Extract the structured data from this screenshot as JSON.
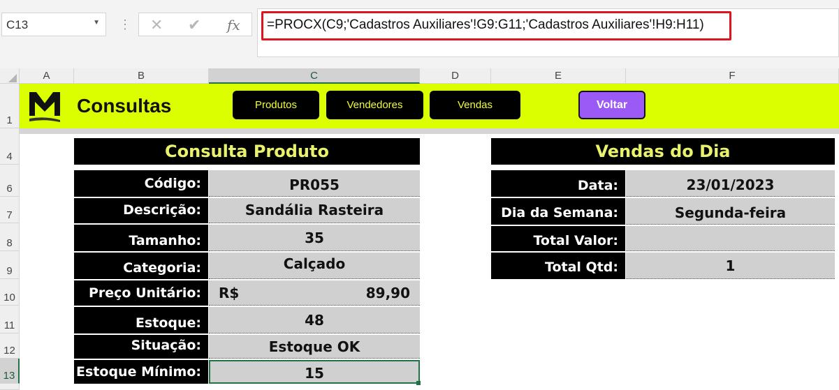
{
  "formula_bar": {
    "name_box": "C13",
    "cancel_icon": "✕",
    "enter_icon": "✔",
    "function_icon": "fx",
    "formula": "=PROCX(C9;'Cadastros Auxiliares'!G9:G11;'Cadastros Auxiliares'!H9:H11)"
  },
  "columns": [
    "A",
    "B",
    "C",
    "D",
    "E",
    "F"
  ],
  "rows": [
    "1",
    "4",
    "6",
    "7",
    "8",
    "9",
    "10",
    "11",
    "12",
    "13"
  ],
  "banner": {
    "title": "Consultas",
    "nav": [
      "Produtos",
      "Vendedores",
      "Vendas"
    ],
    "back": "Voltar",
    "color": "#dcff00"
  },
  "produto": {
    "title": "Consulta Produto",
    "fields": [
      {
        "label": "Código:",
        "value": "PR055"
      },
      {
        "label": "Descrição:",
        "value": "Sandália Rasteira"
      },
      {
        "label": "Tamanho:",
        "value": "35"
      },
      {
        "label": "Categoria:",
        "value": "Calçado"
      },
      {
        "label": "Preço Unitário:",
        "currency": "R$",
        "value": "89,90"
      },
      {
        "label": "Estoque:",
        "value": "48"
      },
      {
        "label": "Situação:",
        "value": "Estoque OK"
      },
      {
        "label": "Estoque Mínimo:",
        "value": "15"
      }
    ]
  },
  "vendas": {
    "title": "Vendas do Dia",
    "fields": [
      {
        "label": "Data:",
        "value": "23/01/2023"
      },
      {
        "label": "Dia da Semana:",
        "value": "Segunda-feira"
      },
      {
        "label": "Total Valor:",
        "value": ""
      },
      {
        "label": "Total Qtd:",
        "value": "1"
      }
    ]
  }
}
